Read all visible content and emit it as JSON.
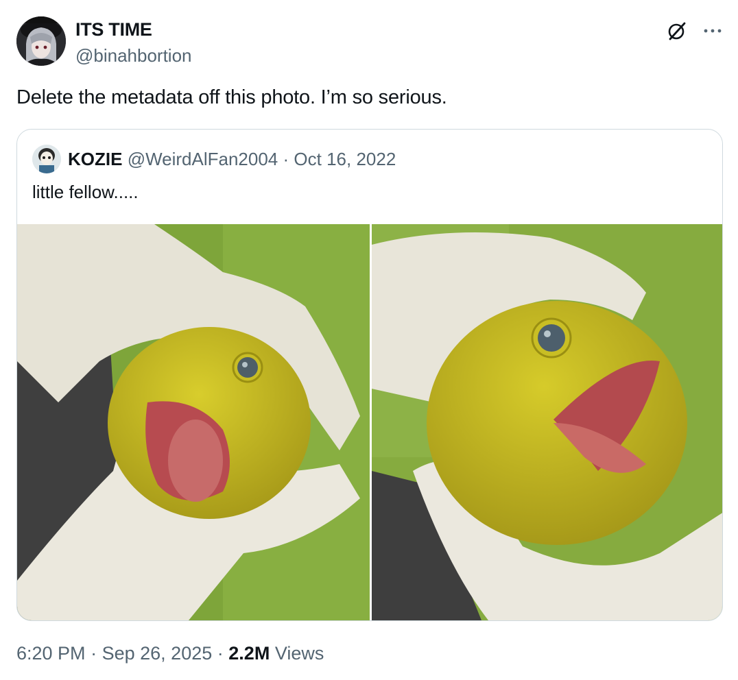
{
  "author": {
    "name": "ITS TIME",
    "handle": "@binahbortion",
    "avatar_icon": "anime-avatar"
  },
  "tweet": {
    "text": "Delete the metadata off this photo. I’m so serious."
  },
  "quoted": {
    "name": "KOZIE",
    "handle": "@WeirdAlFan2004",
    "separator": "·",
    "date": "Oct 16, 2022",
    "text": "little fellow.....",
    "media": [
      "photo-yellow-fish-head-front",
      "photo-yellow-fish-head-side"
    ]
  },
  "footer": {
    "time": "6:20 PM",
    "sep1": "·",
    "date": "Sep 26, 2025",
    "sep2": "·",
    "views_count": "2.2M",
    "views_label": "Views"
  },
  "icons": {
    "grok": "grok-icon",
    "more": "more-icon"
  },
  "colors": {
    "text": "#0f1419",
    "secondary": "#536471",
    "border": "#cfd9de",
    "grass": "#7ea53a",
    "fish": "#c4b81f"
  }
}
